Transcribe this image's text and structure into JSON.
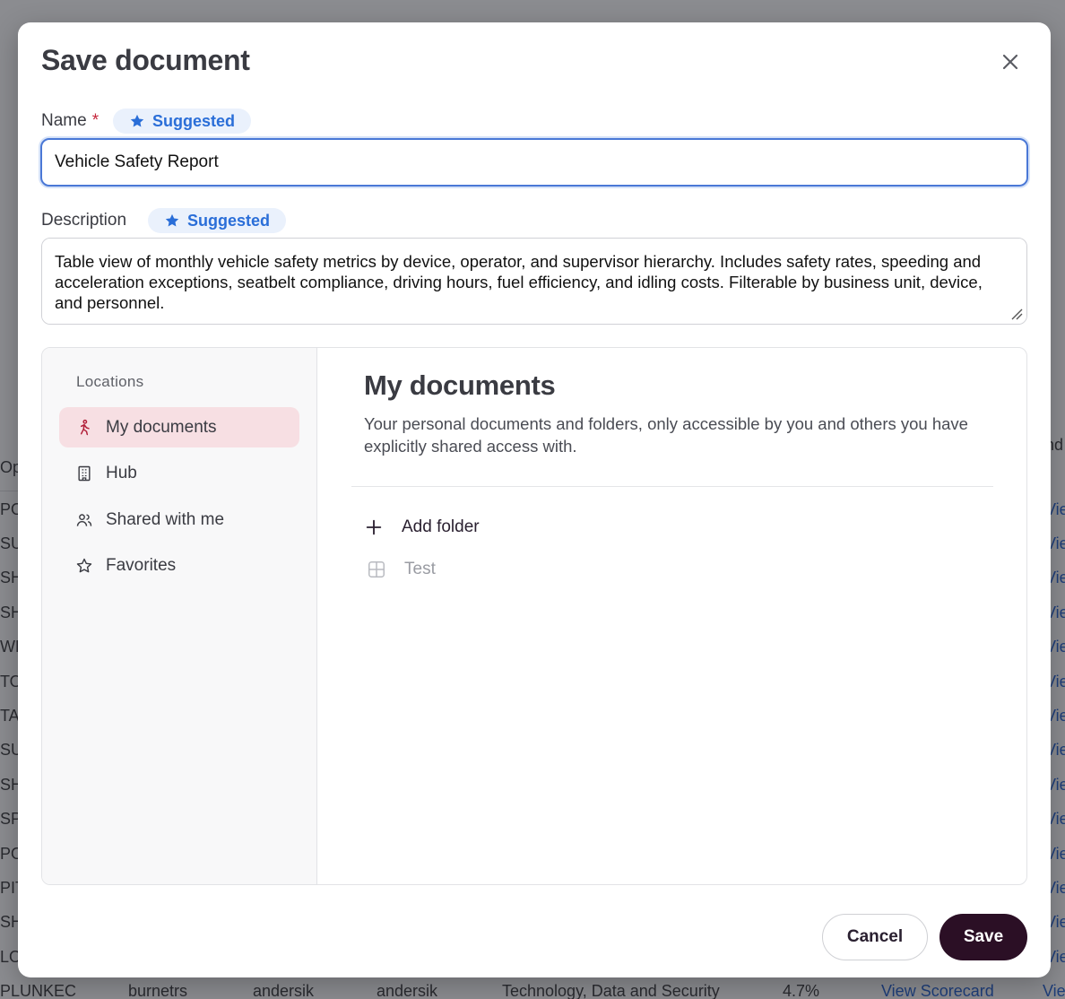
{
  "background": {
    "left_fragments": [
      "Op",
      "PO",
      "SU",
      "SH",
      "SH",
      "WH",
      "TO",
      "TA",
      "SU",
      "SH",
      "SP",
      "PO",
      "PIT",
      "SH",
      "LO"
    ],
    "right_header": "nd",
    "right_link_fragment": "Vie",
    "bottom_row": [
      "PLUNKEC",
      "burnetrs",
      "andersik",
      "andersik",
      "Technology, Data and Security",
      "4.7%",
      "View Scorecard",
      "Vie"
    ]
  },
  "dialog": {
    "title": "Save document",
    "close_icon": "close-icon",
    "name_label": "Name",
    "required_marker": "*",
    "suggested_label": "Suggested",
    "name_value": "Vehicle Safety Report",
    "description_label": "Description",
    "description_value": "Table view of monthly vehicle safety metrics by device, operator, and supervisor hierarchy. Includes safety rates, speeding and acceleration exceptions, seatbelt compliance, driving hours, fuel efficiency, and idling costs. Filterable by business unit, device, and personnel."
  },
  "locations": {
    "heading": "Locations",
    "items": [
      {
        "label": "My documents",
        "icon": "person-walking-icon",
        "active": true
      },
      {
        "label": "Hub",
        "icon": "building-icon",
        "active": false
      },
      {
        "label": "Shared with me",
        "icon": "users-icon",
        "active": false
      },
      {
        "label": "Favorites",
        "icon": "star-icon",
        "active": false
      }
    ]
  },
  "main": {
    "title": "My documents",
    "description": "Your personal documents and folders, only accessible by you and others you have explicitly shared access with.",
    "add_folder_label": "Add folder",
    "folders": [
      {
        "label": "Test",
        "icon": "layout-grid-icon"
      }
    ]
  },
  "footer": {
    "cancel_label": "Cancel",
    "save_label": "Save"
  },
  "colors": {
    "accent_blue": "#2a6ed8",
    "active_item_bg": "#f7dfe3",
    "save_button_bg": "#2b0f25",
    "required": "#c5263b"
  }
}
